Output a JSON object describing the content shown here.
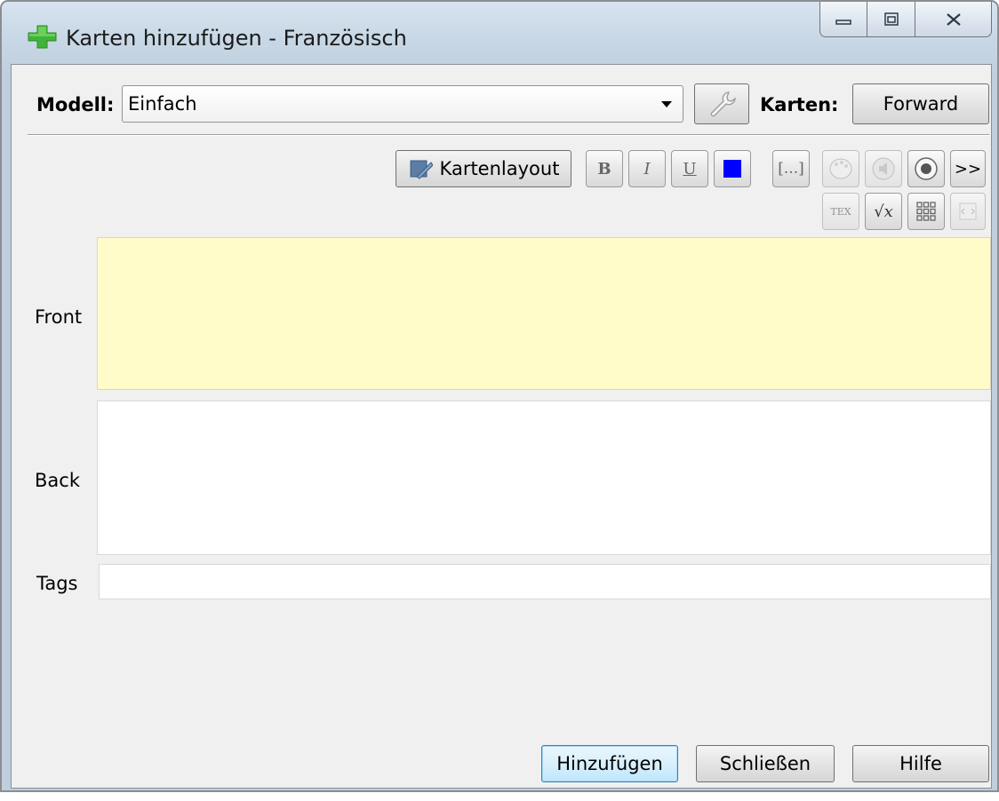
{
  "window": {
    "title": "Karten hinzufügen - Französisch",
    "icon": "green-plus-icon"
  },
  "toolbar": {
    "model_label": "Modell:",
    "model_value": "Einfach",
    "wrench_icon": "wrench-icon",
    "cards_label": "Karten:",
    "cards_button": "Forward"
  },
  "editor_toolbar": {
    "layout_button": "Kartenlayout",
    "bold": "B",
    "italic": "I",
    "underline": "U",
    "text_color": "#0000ff",
    "cloze": "[...]",
    "more": ">>",
    "tex": "TEX",
    "sqrt": "√x"
  },
  "fields": {
    "front_label": "Front",
    "back_label": "Back",
    "tags_label": "Tags",
    "front_value": "",
    "back_value": "",
    "tags_value": ""
  },
  "buttons": {
    "add": "Hinzufügen",
    "close": "Schließen",
    "help": "Hilfe"
  },
  "colors": {
    "focused_field": "#fffcca",
    "accent_blue": "#0000ff"
  }
}
